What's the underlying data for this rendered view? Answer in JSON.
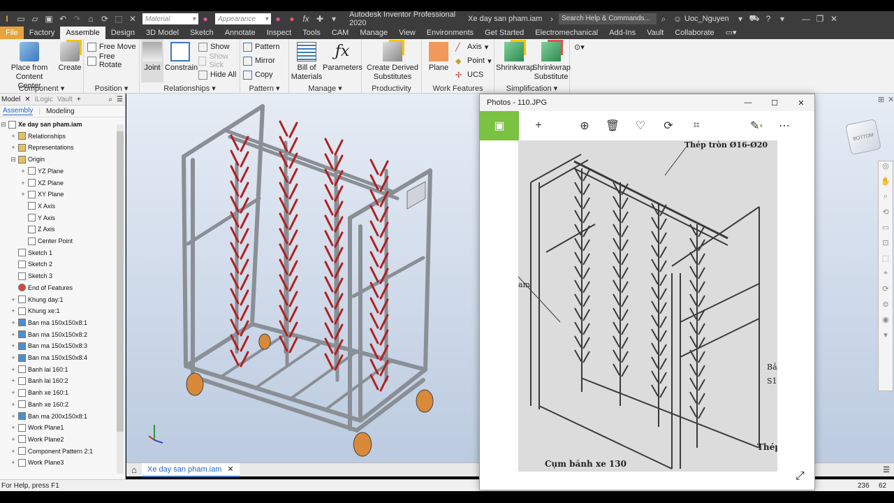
{
  "app": {
    "title": "Autodesk Inventor Professional 2020",
    "document": "Xe day san pham.iam",
    "search_placeholder": "Search Help & Commands...",
    "user": "Uoc_Nguyen"
  },
  "quick_access": {
    "material": "Material",
    "appearance": "Appearance",
    "fx": "fx"
  },
  "tabs": [
    "File",
    "Factory",
    "Assemble",
    "Design",
    "3D Model",
    "Sketch",
    "Annotate",
    "Inspect",
    "Tools",
    "CAM",
    "Manage",
    "View",
    "Environments",
    "Get Started",
    "Electromechanical",
    "Add-Ins",
    "Vault",
    "Collaborate"
  ],
  "ribbon": {
    "component": {
      "label": "Component",
      "place": "Place from\nContent Center",
      "create": "Create"
    },
    "position": {
      "label": "Position",
      "free_move": "Free Move",
      "free_rotate": "Free Rotate"
    },
    "relationships": {
      "label": "Relationships",
      "joint": "Joint",
      "constrain": "Constrain",
      "show": "Show",
      "show_sick": "Show Sick",
      "hide_all": "Hide All"
    },
    "pattern": {
      "label": "Pattern",
      "pattern": "Pattern",
      "mirror": "Mirror",
      "copy": "Copy"
    },
    "manage": {
      "label": "Manage",
      "bom": "Bill of\nMaterials",
      "parameters": "Parameters"
    },
    "productivity": {
      "label": "Productivity",
      "derived": "Create Derived\nSubstitutes"
    },
    "work_features": {
      "label": "Work Features",
      "plane": "Plane",
      "axis": "Axis",
      "point": "Point",
      "ucs": "UCS"
    },
    "simplification": {
      "label": "Simplification",
      "shrinkwrap": "Shrinkwrap",
      "shrinkwrap_sub": "Shrinkwrap\nSubstitute"
    }
  },
  "browser": {
    "tabs": [
      "Model",
      "iLogic",
      "Vault"
    ],
    "subtabs": [
      "Assembly",
      "Modeling"
    ],
    "tree": [
      "Xe day san pham.iam",
      "Relationships",
      "Representations",
      "Origin",
      "YZ Plane",
      "XZ Plane",
      "XY Plane",
      "X Axis",
      "Y Axis",
      "Z Axis",
      "Center Point",
      "Sketch 1",
      "Sketch 2",
      "Sketch 3",
      "End of Features",
      "Khung day:1",
      "Khung xe:1",
      "Ban ma 150x150x8:1",
      "Ban ma 150x150x8:2",
      "Ban ma 150x150x8:3",
      "Ban ma 150x150x8:4",
      "Banh lai 160:1",
      "Banh lai 160:2",
      "Banh xe 160:1",
      "Banh xe 160:2",
      "Ban ma 200x150x8:1",
      "Work Plane1",
      "Work Plane2",
      "Component Pattern 2:1",
      "Work Plane3"
    ]
  },
  "doc_tab": "Xe day san pham.iam",
  "status": {
    "help": "For Help, press F1",
    "n1": "236",
    "n2": "62"
  },
  "photos": {
    "title": "Photos - 110.JPG",
    "annot_top": "Thép tròn Ø16-Ø20",
    "annot_bottom": "Cụm bánh xe 130",
    "annot_left": "am",
    "annot_r1": "Bả",
    "annot_r2": "S1",
    "annot_r3": "Thép"
  },
  "viewcube": "BOTTOM"
}
